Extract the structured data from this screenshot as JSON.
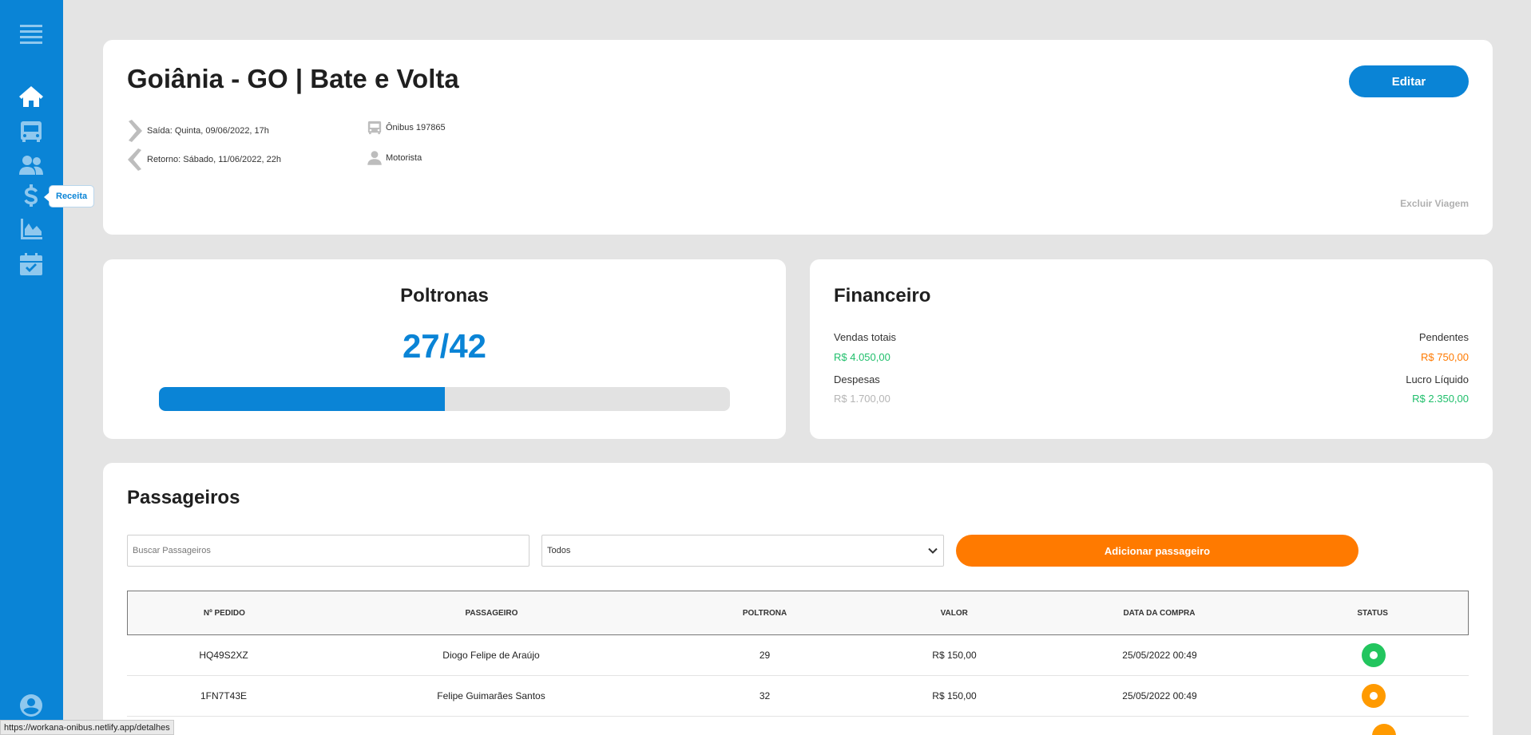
{
  "sidebar": {
    "tooltip": "Receita"
  },
  "trip": {
    "title": "Goiânia - GO | Bate e Volta",
    "edit_label": "Editar",
    "departure": "Saída: Quinta, 09/06/2022, 17h",
    "return": "Retorno: Sábado, 11/06/2022, 22h",
    "bus": "Ônibus 197865",
    "driver": "Motorista",
    "delete_label": "Excluir Viagem"
  },
  "seats": {
    "title": "Poltronas",
    "count": "27/42",
    "progress_fraction": 0.5
  },
  "finance": {
    "title": "Financeiro",
    "total_sales_label": "Vendas totais",
    "total_sales": "R$ 4.050,00",
    "pending_label": "Pendentes",
    "pending": "R$ 750,00",
    "expenses_label": "Despesas",
    "expenses": "R$ 1.700,00",
    "net_profit_label": "Lucro Líquido",
    "net_profit": "R$ 2.350,00"
  },
  "passengers": {
    "title": "Passageiros",
    "search_placeholder": "Buscar Passageiros",
    "filter_value": "Todos",
    "add_label": "Adicionar passageiro",
    "columns": [
      "Nº PEDIDO",
      "PASSAGEIRO",
      "POLTRONA",
      "VALOR",
      "DATA DA COMPRA",
      "STATUS"
    ],
    "rows": [
      {
        "order": "HQ49S2XZ",
        "name": "Diogo Felipe de Araújo",
        "seat": "29",
        "value": "R$ 150,00",
        "date": "25/05/2022 00:49",
        "status_color": "#22c55e"
      },
      {
        "order": "1FN7T43E",
        "name": "Felipe Guimarães Santos",
        "seat": "32",
        "value": "R$ 150,00",
        "date": "25/05/2022 00:49",
        "status_color": "#ff9a00"
      }
    ]
  },
  "statusbar": {
    "url": "https://workana-onibus.netlify.app/detalhes"
  },
  "colors": {
    "primary": "#0a84d6",
    "accent": "#ff7a00",
    "positive": "#1fbf6b"
  }
}
